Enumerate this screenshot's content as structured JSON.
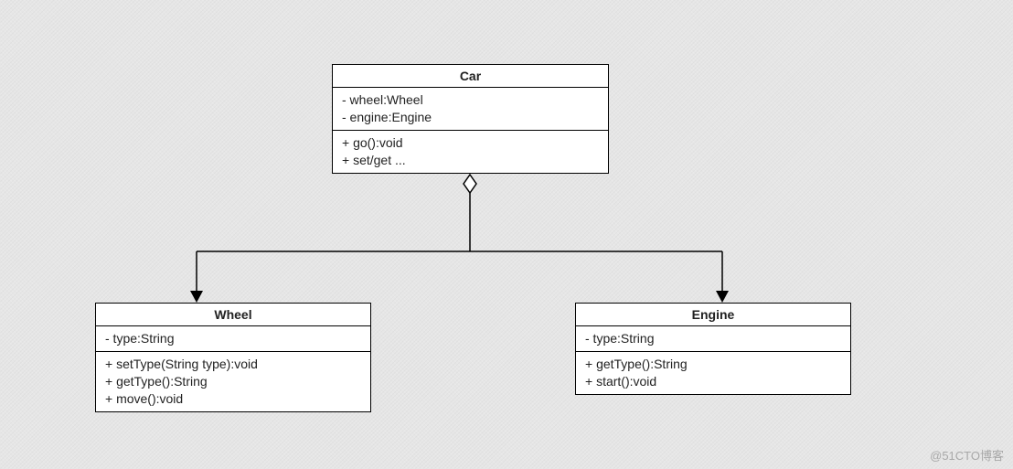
{
  "classes": {
    "car": {
      "name": "Car",
      "attrs": [
        "- wheel:Wheel",
        "- engine:Engine"
      ],
      "ops": [
        "+ go():void",
        "+ set/get ..."
      ]
    },
    "wheel": {
      "name": "Wheel",
      "attrs": [
        "- type:String"
      ],
      "ops": [
        "+ setType(String type):void",
        "+ getType():String",
        "+ move():void"
      ]
    },
    "engine": {
      "name": "Engine",
      "attrs": [
        "- type:String"
      ],
      "ops": [
        "+ getType():String",
        "+ start():void"
      ]
    }
  },
  "watermark": "@51CTO博客"
}
